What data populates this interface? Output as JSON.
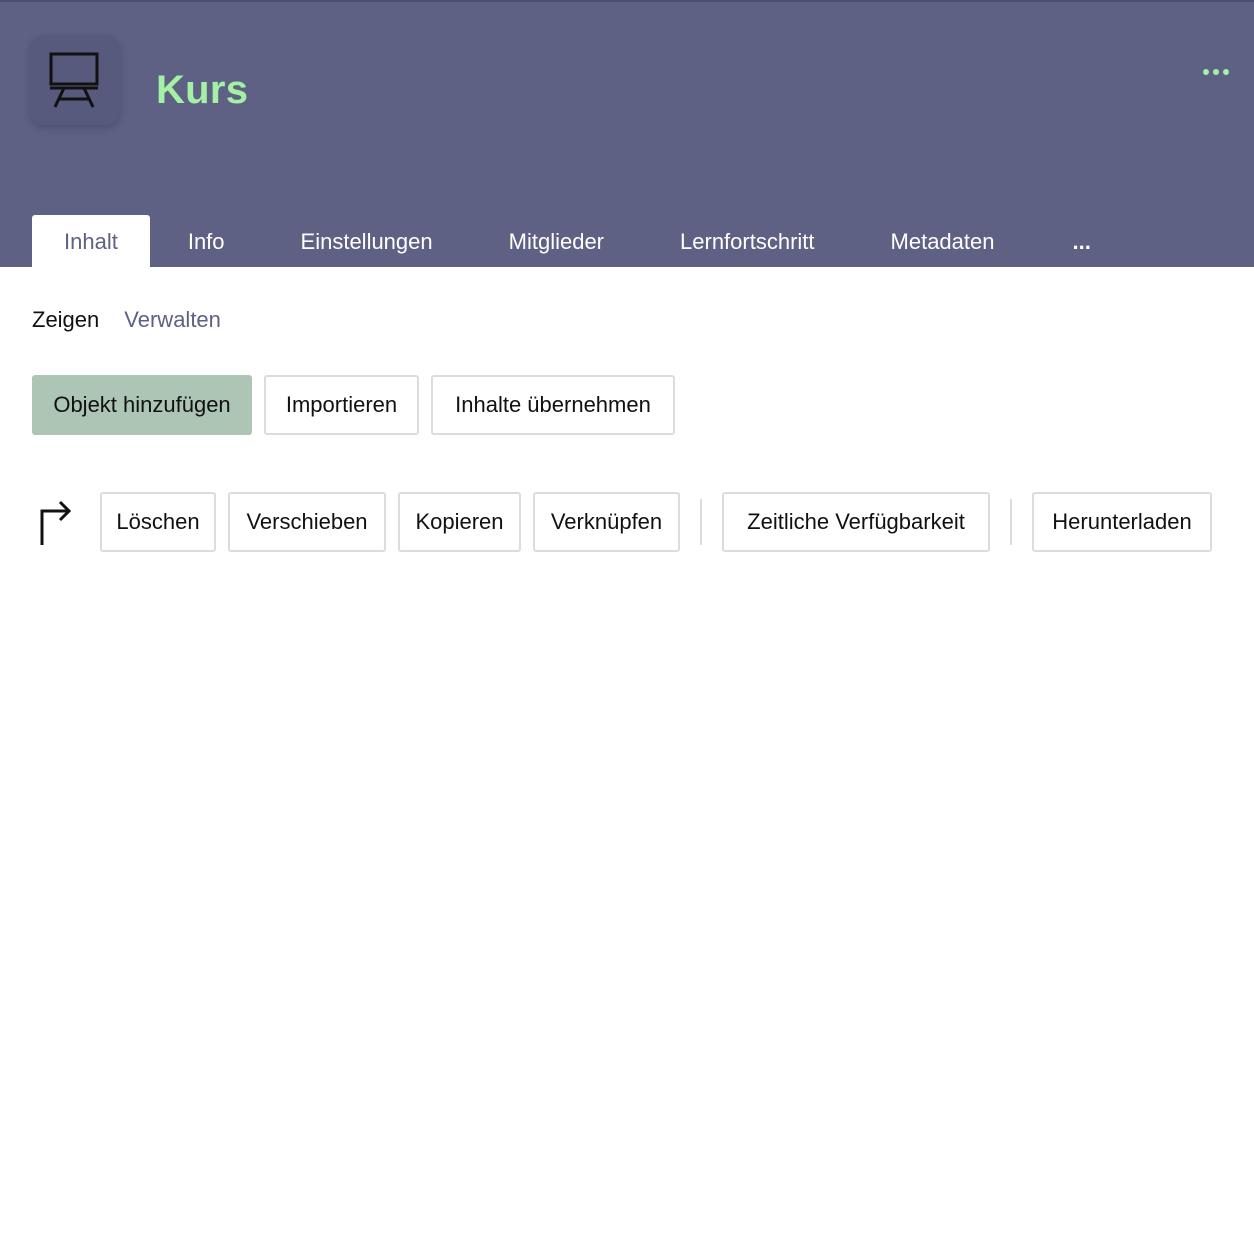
{
  "header": {
    "title": "Kurs",
    "icon": "course-board-icon",
    "more_icon": "more-horizontal-icon",
    "title_color": "#a4f0a4",
    "background": "#5e6184"
  },
  "tabs": [
    {
      "label": "Inhalt",
      "active": true
    },
    {
      "label": "Info"
    },
    {
      "label": "Einstellungen"
    },
    {
      "label": "Mitglieder"
    },
    {
      "label": "Lernfortschritt"
    },
    {
      "label": "Metadaten"
    },
    {
      "label": "..."
    }
  ],
  "subtabs": [
    {
      "label": "Zeigen",
      "active": true
    },
    {
      "label": "Verwalten"
    }
  ],
  "actions": {
    "add_object": "Objekt hinzufügen",
    "import": "Importieren",
    "take_over_content": "Inhalte übernehmen"
  },
  "multi_actions": {
    "icon": "corner-arrow-icon",
    "delete": "Löschen",
    "move": "Verschieben",
    "copy": "Kopieren",
    "link": "Verknüpfen",
    "availability": "Zeitliche Verfügbarkeit",
    "download": "Herunterladen"
  }
}
